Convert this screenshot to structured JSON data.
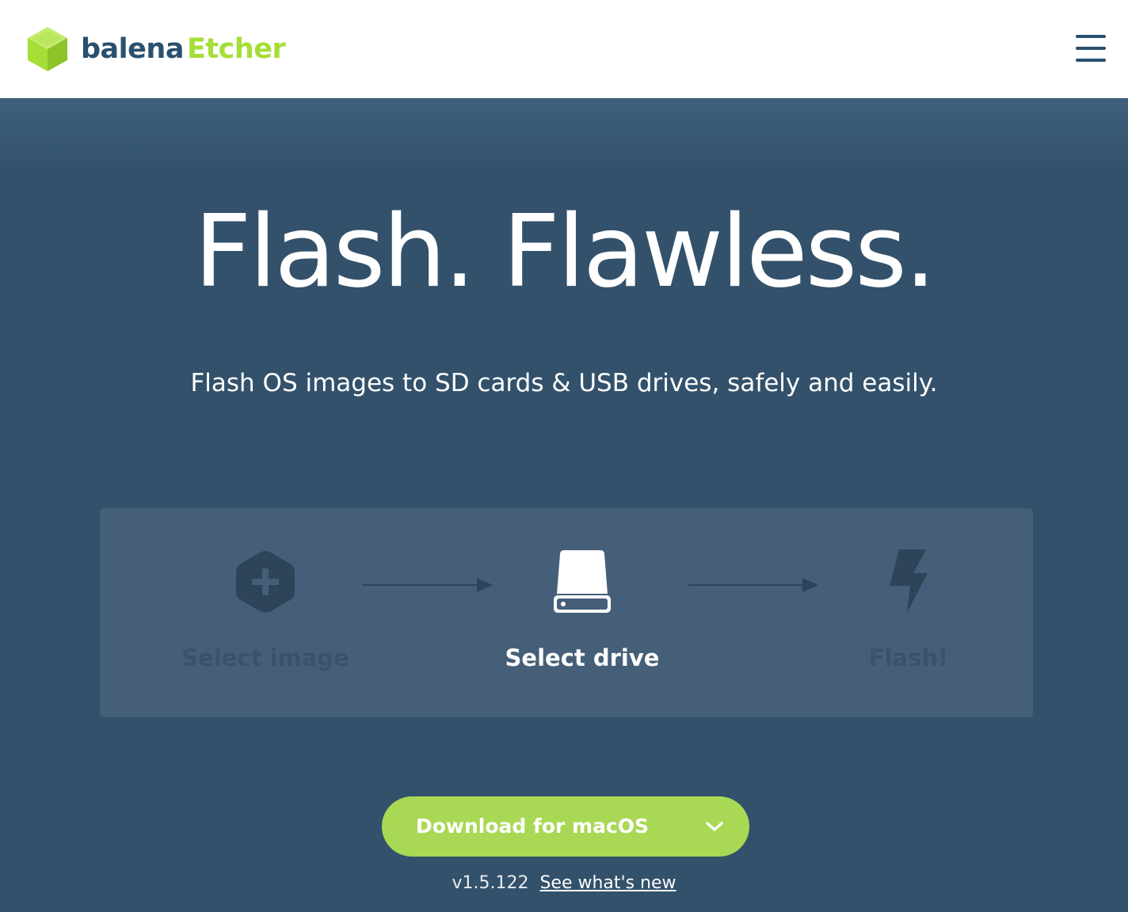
{
  "header": {
    "brand_primary": "balena",
    "brand_secondary": "Etcher",
    "logo_icon": "cube-icon",
    "menu_icon": "hamburger-menu-icon"
  },
  "hero": {
    "headline": "Flash. Flawless.",
    "subtitle": "Flash OS images to SD cards & USB drives, safely and easily."
  },
  "steps": [
    {
      "label": "Select image",
      "icon": "plus-hexagon-icon",
      "state": "inactive"
    },
    {
      "label": "Select drive",
      "icon": "drive-icon",
      "state": "active"
    },
    {
      "label": "Flash!",
      "icon": "lightning-bolt-icon",
      "state": "inactive"
    }
  ],
  "download": {
    "label": "Download for macOS",
    "dropdown_icon": "chevron-down-icon",
    "version": "v1.5.122",
    "whats_new_link": "See what's new"
  },
  "colors": {
    "brand_dark": "#2a506f",
    "brand_green": "#a5de37",
    "hero_bg": "#33516b",
    "panel_bg": "#465f78",
    "button_green": "#a9d854"
  }
}
